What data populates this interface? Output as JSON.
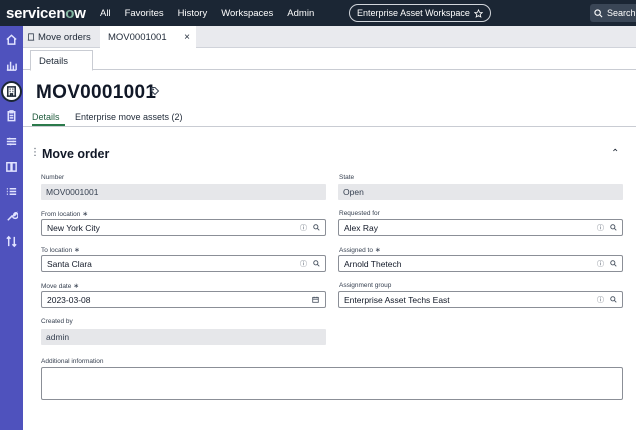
{
  "topbar": {
    "logo": "servicenow",
    "nav": [
      "All",
      "Favorites",
      "History",
      "Workspaces",
      "Admin"
    ],
    "workspace": "Enterprise Asset Workspace",
    "search": "Search"
  },
  "tabs": {
    "list_tab": "Move orders",
    "record_tab": "MOV0001001",
    "close": "×"
  },
  "subtab": "Details",
  "record": {
    "title": "MOV0001001"
  },
  "related_tabs": [
    "Details",
    "Enterprise move assets (2)"
  ],
  "section": {
    "title": "Move order"
  },
  "fields": {
    "number": {
      "label": "Number",
      "value": "MOV0001001"
    },
    "state": {
      "label": "State",
      "value": "Open"
    },
    "from_location": {
      "label": "From location",
      "value": "New York City"
    },
    "requested_for": {
      "label": "Requested for",
      "value": "Alex Ray"
    },
    "to_location": {
      "label": "To location",
      "value": "Santa Clara"
    },
    "assigned_to": {
      "label": "Assigned to",
      "value": "Arnold Thetech"
    },
    "move_date": {
      "label": "Move date",
      "value": "2023-03-08"
    },
    "assignment_group": {
      "label": "Assignment group",
      "value": "Enterprise Asset Techs East"
    },
    "created_by": {
      "label": "Created by",
      "value": "admin"
    },
    "additional_information": {
      "label": "Additional information",
      "value": ""
    }
  },
  "required_mark": "∗",
  "colors": {
    "topbar": "#1b2634",
    "leftbar": "#4f52bd",
    "active_tab": "#2b7a4b"
  }
}
